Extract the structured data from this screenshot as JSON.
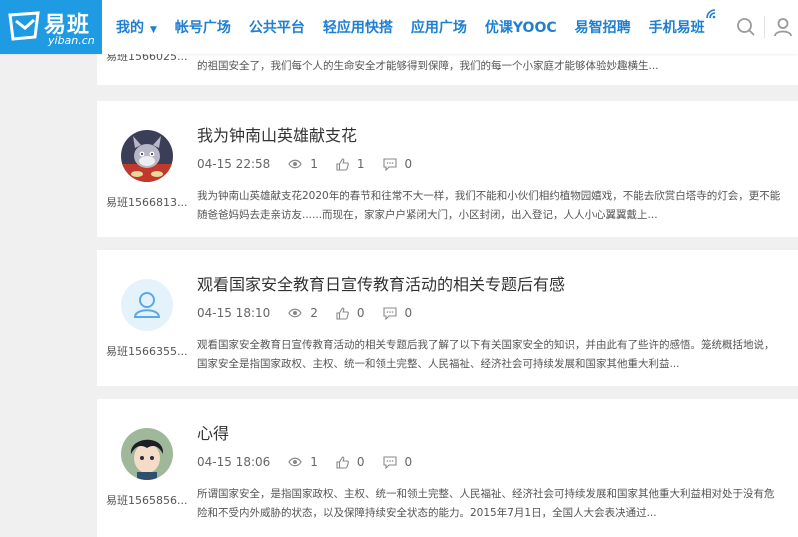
{
  "brand": {
    "name_cn": "易班",
    "name_en": "yiban.cn",
    "color": "#1f9be3"
  },
  "nav": [
    {
      "label": "我的",
      "has_caret": true
    },
    {
      "label": "帐号广场"
    },
    {
      "label": "公共平台"
    },
    {
      "label": "轻应用快搭"
    },
    {
      "label": "应用广场"
    },
    {
      "label": "优课YOOC"
    },
    {
      "label": "易智招聘"
    },
    {
      "label": "手机易班"
    }
  ],
  "header_tools": [
    "search-icon",
    "user-icon",
    "menu-icon"
  ],
  "posts": [
    {
      "username": "易班1566025...",
      "excerpt_lines": [
        "",
        "的祖国安全了，我们每个人的生命安全才能够得到保障，我们的每一个小家庭才能够体验妙趣横生..."
      ]
    },
    {
      "title": "我为钟南山英雄献支花",
      "date": "04-15 22:58",
      "views": "1",
      "likes": "1",
      "comments": "0",
      "username": "易班1566813...",
      "avatar": "cartoon-cat",
      "excerpt_lines": [
        "我为钟南山英雄献支花2020年的春节和往常不大一样，我们不能和小伙们相约植物园嬉戏，不能去欣赏白塔寺的灯会，更不能",
        "随爸爸妈妈去走亲访友......而现在，家家户户紧闭大门，小区封闭，出入登记，人人小心翼翼戴上..."
      ]
    },
    {
      "title": "观看国家安全教育日宣传教育活动的相关专题后有感",
      "date": "04-15 18:10",
      "views": "2",
      "likes": "0",
      "comments": "0",
      "username": "易班1566355...",
      "avatar": "default",
      "excerpt_lines": [
        "观看国家安全教育日宣传教育活动的相关专题后我了解了以下有关国家安全的知识，并由此有了些许的感悟。笼统概括地说，",
        "国家安全是指国家政权、主权、统一和领土完整、人民福祉、经济社会可持续发展和国家其他重大利益..."
      ]
    },
    {
      "title": "心得",
      "date": "04-15 18:06",
      "views": "1",
      "likes": "0",
      "comments": "0",
      "username": "易班1565856...",
      "avatar": "anime-boy",
      "excerpt_lines": [
        "所谓国家安全，是指国家政权、主权、统一和领土完整、人民福祉、经济社会可持续发展和国家其他重大利益相对处于没有危",
        "险和不受内外威胁的状态，以及保障持续安全状态的能力。2015年7月1日，全国人大会表决通过..."
      ]
    }
  ]
}
